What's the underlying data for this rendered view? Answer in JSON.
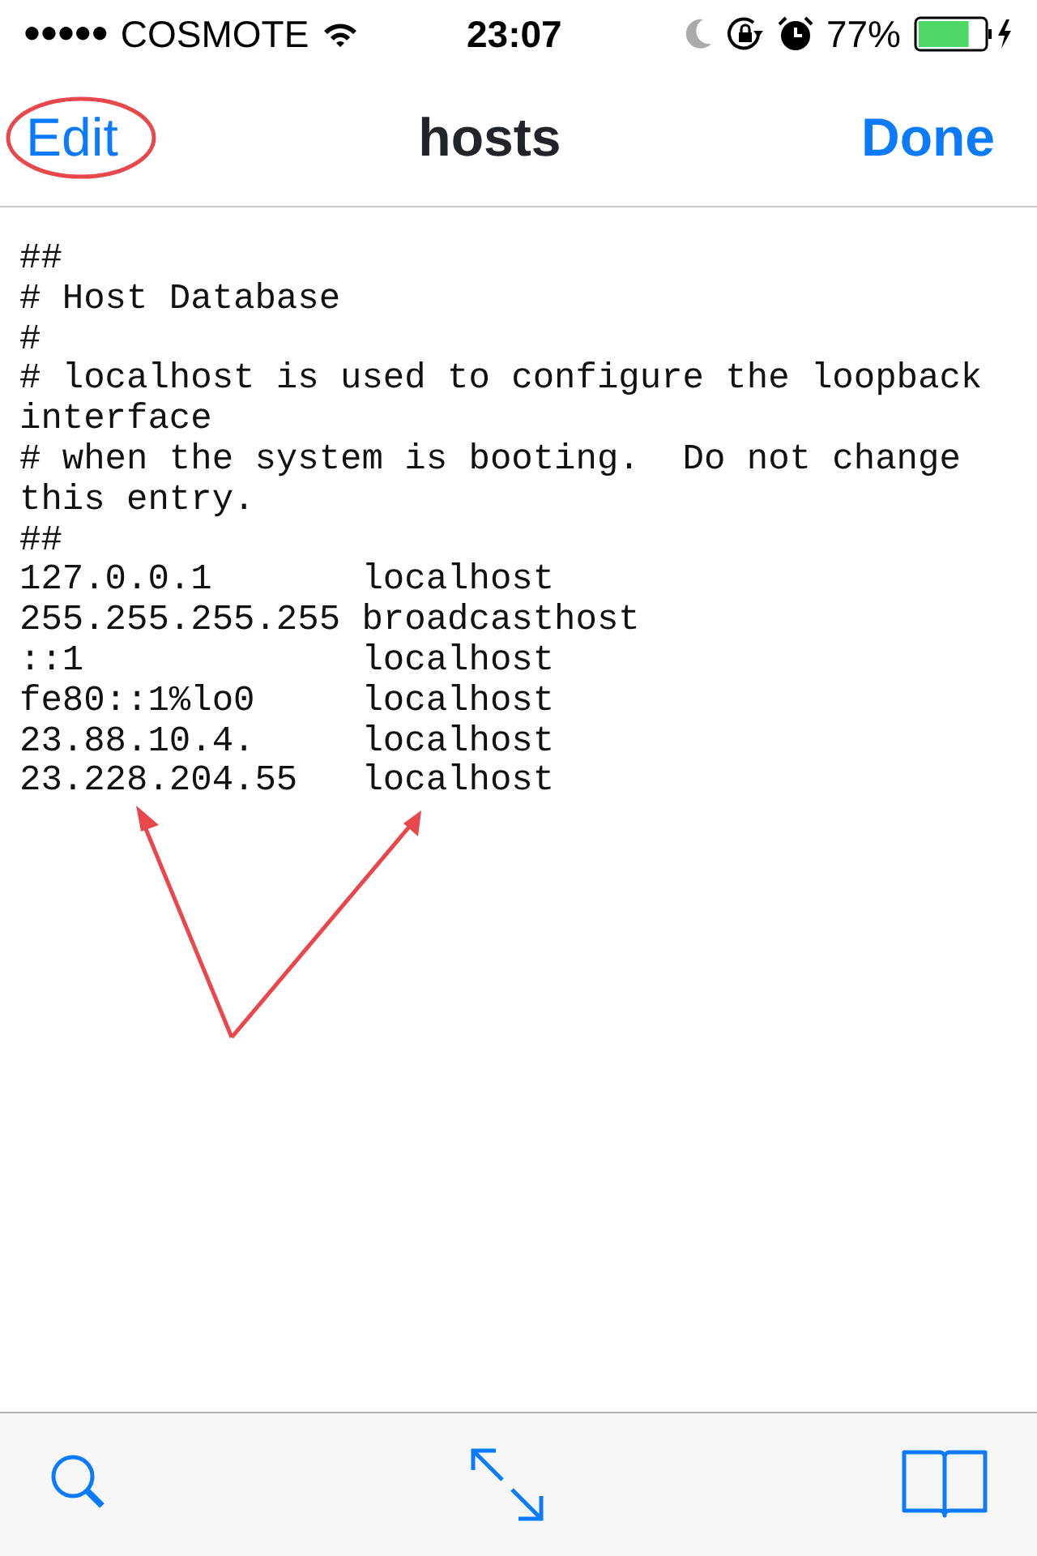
{
  "status_bar": {
    "signal_bars": "●●●●●",
    "carrier": "COSMOTE",
    "time": "23:07",
    "battery": "77%",
    "level": 0.77
  },
  "nav": {
    "left": "Edit",
    "title": "hosts",
    "right": "Done"
  },
  "lines": [
    "##",
    "# Host Database",
    "#",
    "# localhost is used to configure the loopback",
    "interface",
    "# when the system is booting.  Do not change",
    "this entry.",
    "##",
    "127.0.0.1       localhost",
    "255.255.255.255 broadcasthost",
    "::1             localhost",
    "fe80::1%lo0     localhost",
    "23.88.10.4.     localhost",
    "23.228.204.55   localhost"
  ],
  "annotations": {
    "edit_circled": true,
    "arrows": true
  },
  "toolbar": [
    {
      "kind": "search"
    },
    {
      "kind": "resize"
    },
    {
      "kind": "book"
    }
  ]
}
